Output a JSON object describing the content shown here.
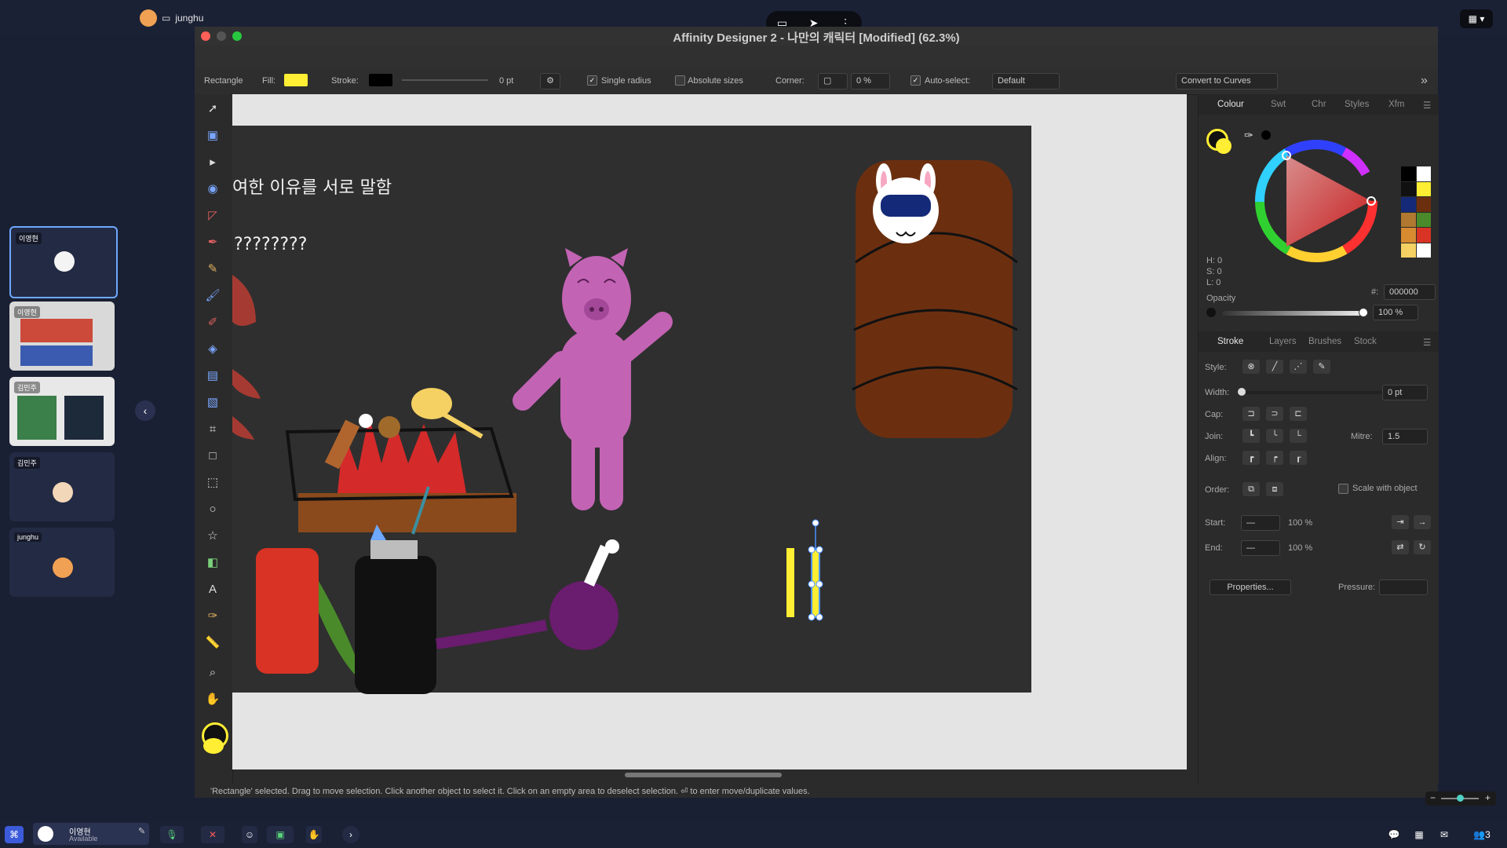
{
  "app": {
    "title": "Affinity Designer 2 - 나만의 캐릭터 [Modified] (62.3%)"
  },
  "meeting": {
    "top_user": "junghu",
    "participants": [
      {
        "name": "이영현"
      },
      {
        "name": "이영현"
      },
      {
        "name": "김민주"
      },
      {
        "name": "김민주"
      },
      {
        "name": "junghu"
      }
    ],
    "self_name": "이영현",
    "self_status": "Available",
    "participant_count": "3"
  },
  "context_toolbar": {
    "shape_label": "Rectangle",
    "fill_label": "Fill:",
    "stroke_label": "Stroke:",
    "stroke_width": "0 pt",
    "single_radius": "Single radius",
    "absolute_sizes": "Absolute sizes",
    "corner_label": "Corner:",
    "corner_value": "0 %",
    "auto_select": "Auto-select:",
    "auto_select_value": "Default",
    "convert_button": "Convert to Curves",
    "fill_color": "#ffee33",
    "stroke_color": "#000000"
  },
  "canvas": {
    "text_line1": "여한 이유를 서로 말함",
    "text_line2": "????????"
  },
  "colour_panel": {
    "tabs": [
      "Colour",
      "Swt",
      "Chr",
      "Styles",
      "Xfm"
    ],
    "active_tab": "Colour",
    "h": "H: 0",
    "s": "S: 0",
    "l": "L: 0",
    "hex_label": "#:",
    "hex_value": "000000",
    "opacity_label": "Opacity",
    "opacity_value": "100 %"
  },
  "stroke_panel": {
    "tabs": [
      "Stroke",
      "Layers",
      "Brushes",
      "Stock"
    ],
    "active_tab": "Stroke",
    "style_label": "Style:",
    "width_label": "Width:",
    "width_value": "0 pt",
    "cap_label": "Cap:",
    "join_label": "Join:",
    "mitre_label": "Mitre:",
    "mitre_value": "1.5",
    "align_label": "Align:",
    "order_label": "Order:",
    "scale_with_object": "Scale with object",
    "start_label": "Start:",
    "start_pct": "100 %",
    "end_label": "End:",
    "end_pct": "100 %",
    "properties_button": "Properties...",
    "pressure_label": "Pressure:"
  },
  "status_bar": {
    "text": "'Rectangle' selected. Drag to move selection. Click another object to select it. Click on an empty area to deselect selection. ⏎ to enter move/duplicate values."
  }
}
